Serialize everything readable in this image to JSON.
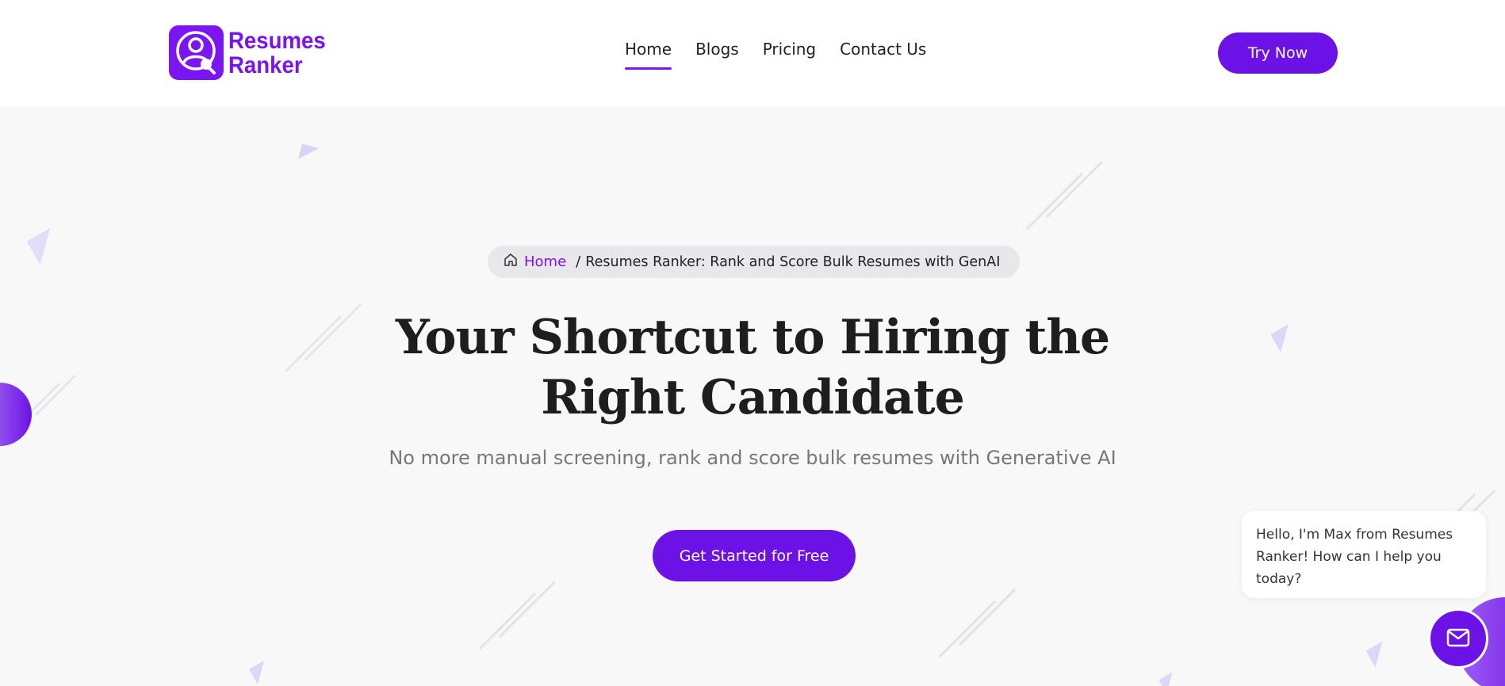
{
  "brand": {
    "name_line1": "Resumes",
    "name_line2": "Ranker",
    "color": "#7b16f2"
  },
  "nav": {
    "items": [
      {
        "label": "Home",
        "active": true
      },
      {
        "label": "Blogs",
        "active": false
      },
      {
        "label": "Pricing",
        "active": false
      },
      {
        "label": "Contact Us",
        "active": false
      }
    ],
    "cta_label": "Try Now"
  },
  "breadcrumb": {
    "home_icon": "home-icon",
    "home_label": "Home",
    "separator": "/",
    "current": "Resumes Ranker: Rank and Score Bulk Resumes with GenAI"
  },
  "hero": {
    "title_line1": "Your Shortcut to Hiring the",
    "title_line2": "Right Candidate",
    "subtitle": "No more manual screening, rank and score bulk resumes with Generative AI",
    "cta_label": "Get Started for Free"
  },
  "chat": {
    "message": "Hello, I'm Max from Resumes Ranker! How can I help you today?",
    "button_icon": "mail-icon"
  },
  "colors": {
    "accent": "#6d12e6",
    "background": "#f8f8f9",
    "text": "#1e1e1e"
  }
}
